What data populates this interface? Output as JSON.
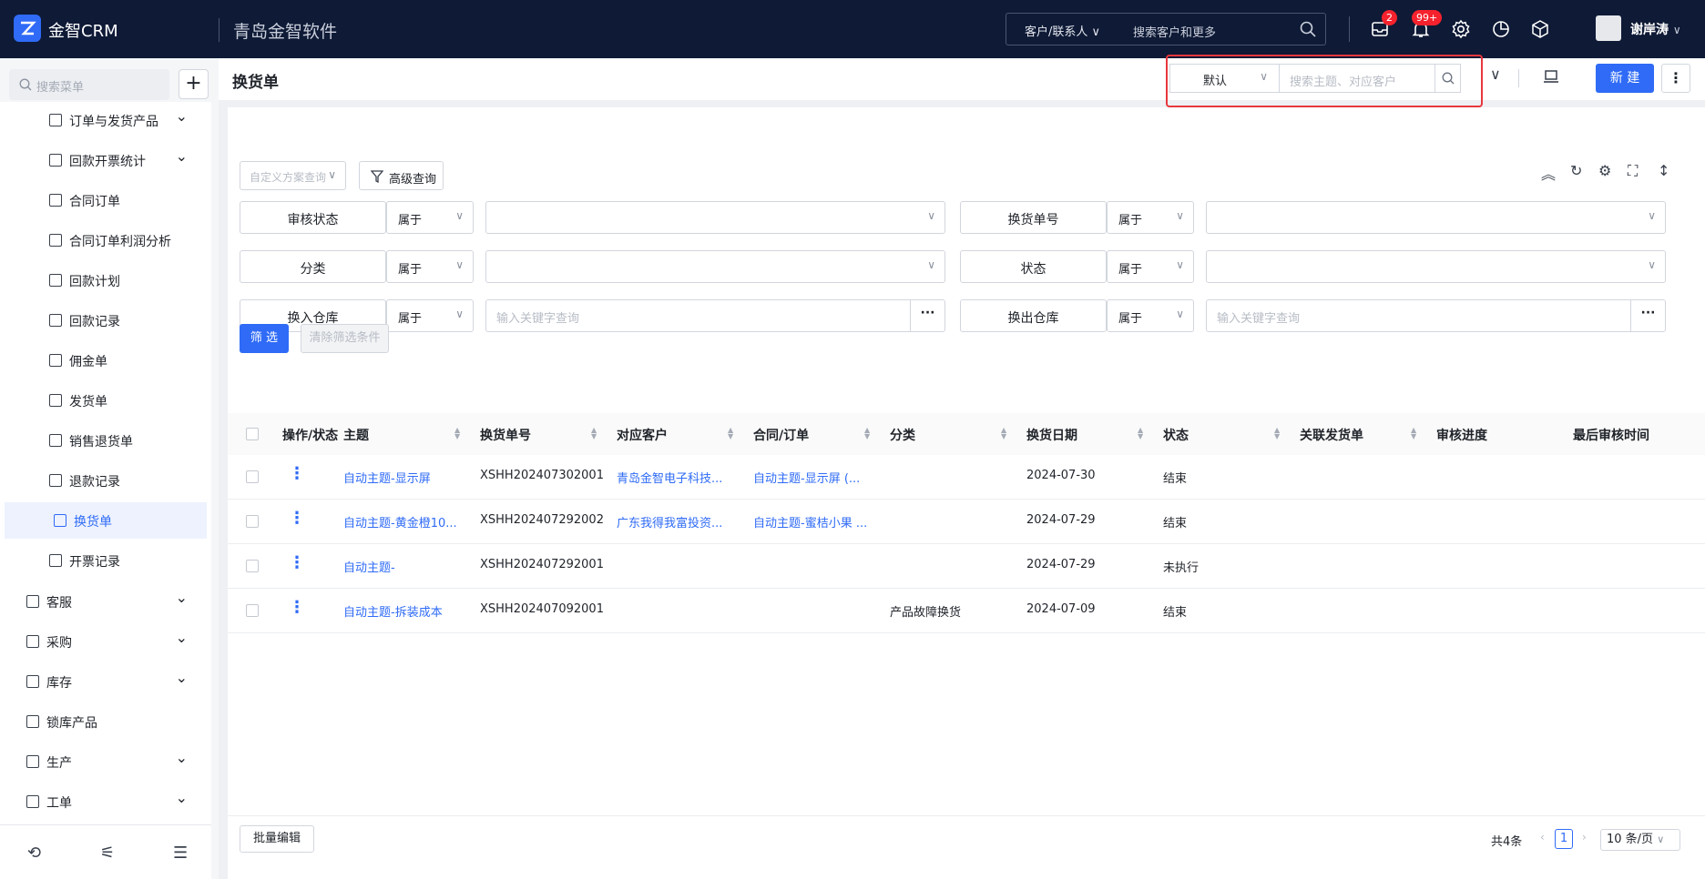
{
  "topbar": {
    "brand": "金智CRM",
    "company": "青岛金智软件",
    "search_scope": "客户/联系人",
    "search_placeholder": "搜索客户和更多",
    "mail_badge": "2",
    "notify_badge": "99+",
    "user_name": "谢岸涛"
  },
  "sidebar": {
    "search_placeholder": "搜索菜单",
    "add_label": "+",
    "items": [
      {
        "label": "订单与发货产品",
        "expandable": true,
        "level": 2
      },
      {
        "label": "回款开票统计",
        "expandable": true,
        "level": 2
      },
      {
        "label": "合同订单",
        "level": 2
      },
      {
        "label": "合同订单利润分析",
        "level": 2
      },
      {
        "label": "回款计划",
        "level": 2
      },
      {
        "label": "回款记录",
        "level": 2
      },
      {
        "label": "佣金单",
        "level": 2
      },
      {
        "label": "发货单",
        "level": 2
      },
      {
        "label": "销售退货单",
        "level": 2
      },
      {
        "label": "退款记录",
        "level": 2
      },
      {
        "label": "换货单",
        "level": 2,
        "active": true
      },
      {
        "label": "开票记录",
        "level": 2
      },
      {
        "label": "客服",
        "expandable": true,
        "level": 1
      },
      {
        "label": "采购",
        "expandable": true,
        "level": 1
      },
      {
        "label": "库存",
        "expandable": true,
        "level": 1
      },
      {
        "label": "锁库产品",
        "level": 1
      },
      {
        "label": "生产",
        "expandable": true,
        "level": 1
      },
      {
        "label": "工单",
        "expandable": true,
        "level": 1
      }
    ]
  },
  "header": {
    "title": "换货单",
    "view_select": "默认",
    "quick_search_placeholder": "搜索主题、对应客户",
    "new_button": "新 建"
  },
  "toolbar": {
    "custom_query": "自定义方案查询",
    "advanced_query": "高级查询"
  },
  "filters": [
    {
      "label": "审核状态",
      "op": "属于",
      "value_placeholder": "",
      "type": "select"
    },
    {
      "label": "换货单号",
      "op": "属于",
      "value_placeholder": "",
      "type": "select"
    },
    {
      "label": "分类",
      "op": "属于",
      "value_placeholder": "",
      "type": "select"
    },
    {
      "label": "状态",
      "op": "属于",
      "value_placeholder": "",
      "type": "select"
    },
    {
      "label": "换入仓库",
      "op": "属于",
      "value_placeholder": "输入关键字查询",
      "type": "lookup"
    },
    {
      "label": "换出仓库",
      "op": "属于",
      "value_placeholder": "输入关键字查询",
      "type": "lookup"
    }
  ],
  "filter_buttons": {
    "apply": "筛 选",
    "clear": "清除筛选条件"
  },
  "table": {
    "columns": [
      "操作/状态",
      "主题",
      "换货单号",
      "对应客户",
      "合同/订单",
      "分类",
      "换货日期",
      "状态",
      "关联发货单",
      "审核进度",
      "最后审核时间"
    ],
    "rows": [
      {
        "subject": "自动主题-显示屏",
        "no": "XSHH202407302001",
        "customer": "青岛金智电子科技...",
        "contract": "自动主题-显示屏 (...",
        "category": "",
        "date": "2024-07-30",
        "status": "结束"
      },
      {
        "subject": "自动主题-黄金橙10...",
        "no": "XSHH202407292002",
        "customer": "广东我得我富投资...",
        "contract": "自动主题-蜜桔小果 ...",
        "category": "",
        "date": "2024-07-29",
        "status": "结束"
      },
      {
        "subject": "自动主题-",
        "no": "XSHH202407292001",
        "customer": "",
        "contract": "",
        "category": "",
        "date": "2024-07-29",
        "status": "未执行"
      },
      {
        "subject": "自动主题-拆装成本",
        "no": "XSHH202407092001",
        "customer": "",
        "contract": "",
        "category": "产品故障换货",
        "date": "2024-07-09",
        "status": "结束"
      }
    ]
  },
  "footer": {
    "batch_edit": "批量编辑",
    "total": "共4条",
    "current_page": "1",
    "page_size": "10 条/页"
  },
  "colors": {
    "accent": "#2f6bf6",
    "topbar_bg": "#0e1a36",
    "highlight_box": "#e8383d",
    "badge": "#f5222d"
  }
}
